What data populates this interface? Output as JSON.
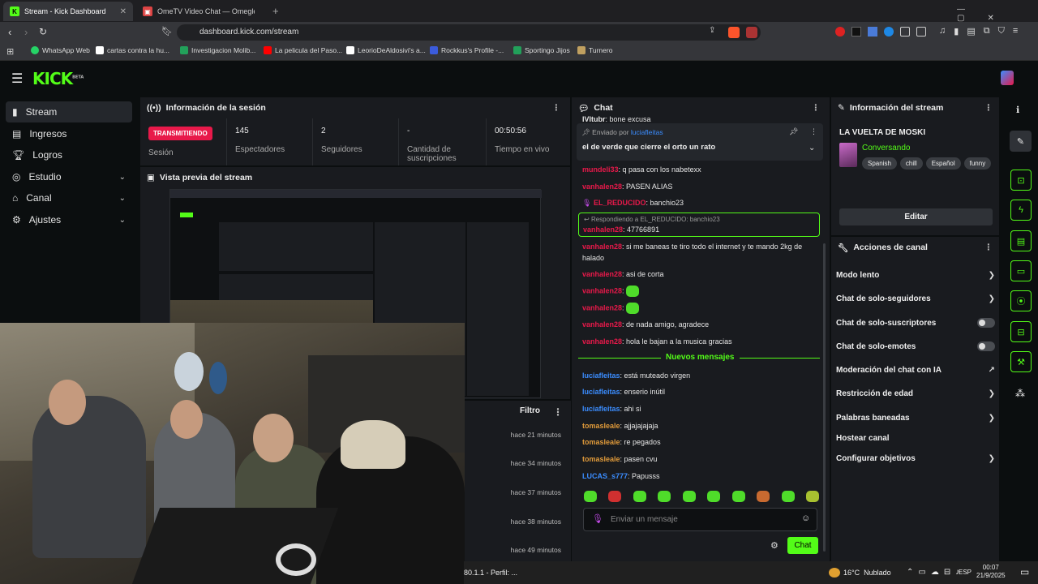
{
  "browser": {
    "tabs": [
      {
        "title": "Stream - Kick Dashboard",
        "active": true
      },
      {
        "title": "OmeTV Video Chat — Omegle Rand",
        "active": false
      }
    ],
    "url": "dashboard.kick.com/stream",
    "bookmarks": [
      {
        "label": "WhatsApp Web",
        "color": "#25d366"
      },
      {
        "label": "cartas contra la hu...",
        "color": "#ffffff"
      },
      {
        "label": "Investigacion Molib...",
        "color": "#22a05a"
      },
      {
        "label": "La pelicula del Paso...",
        "color": "#ff0000"
      },
      {
        "label": "LeorioDeAldosivi's a...",
        "color": "#ffffff"
      },
      {
        "label": "Rockkus's Profile -...",
        "color": "#3b5bdb"
      },
      {
        "label": "Sportingo Jijos",
        "color": "#22a05a"
      },
      {
        "label": "Turnero",
        "color": "#c0a060"
      }
    ]
  },
  "brand": {
    "logo": "KICK",
    "beta": "BETA",
    "accent": "#53fc18"
  },
  "nav": [
    {
      "label": "Stream",
      "icon": "broadcast-icon",
      "active": true,
      "chevron": false
    },
    {
      "label": "Ingresos",
      "icon": "wallet-icon",
      "active": false,
      "chevron": false
    },
    {
      "label": "Logros",
      "icon": "trophy-icon",
      "active": false,
      "chevron": false
    },
    {
      "label": "Estudio",
      "icon": "studio-icon",
      "active": false,
      "chevron": true
    },
    {
      "label": "Canal",
      "icon": "channel-icon",
      "active": false,
      "chevron": true
    },
    {
      "label": "Ajustes",
      "icon": "gear-icon",
      "active": false,
      "chevron": true
    }
  ],
  "session": {
    "title": "Información de la sesión",
    "status": "TRANSMITIENDO",
    "status_label": "Sesión",
    "stats": [
      {
        "value": "145",
        "label": "Espectadores"
      },
      {
        "value": "2",
        "label": "Seguidores"
      },
      {
        "value": "-",
        "label": "Cantidad de suscripciones"
      },
      {
        "value": "00:50:56",
        "label": "Tiempo en vivo"
      }
    ]
  },
  "preview": {
    "title": "Vista previa del stream"
  },
  "filter": {
    "label": "Filtro",
    "times": [
      "hace 21 minutos",
      "hace 34 minutos",
      "hace 37 minutos",
      "hace 38 minutos",
      "hace 49 minutos"
    ]
  },
  "chat": {
    "title": "Chat",
    "top_partial": {
      "user": "IVItubr",
      "text": ": bone excusa"
    },
    "pinned": {
      "prefix": "Enviado por",
      "user": "luciafleitas",
      "text": "el de verde que cierre el orto un rato"
    },
    "messages_old": [
      {
        "user": "mundeli33",
        "text": ": q pasa con los nabetexx",
        "color": "#e8194a"
      },
      {
        "user": "vanhalen28",
        "text": ": PASEN ALIAS",
        "color": "#e8194a"
      },
      {
        "user": "EL_REDUCIDO",
        "text": ": banchio23",
        "color": "#e8194a"
      }
    ],
    "reply": {
      "header": "Respondiendo a EL_REDUCIDO: banchio23",
      "user": "vanhalen28",
      "text": ": 47766891"
    },
    "messages_mid": [
      {
        "user": "vanhalen28",
        "text": ": si me baneas te tiro todo el internet y te mando 2kg de",
        "cont": "halado"
      },
      {
        "user": "vanhalen28",
        "text": ": asi de corta"
      },
      {
        "user": "vanhalen28",
        "text": ":",
        "emote": true
      },
      {
        "user": "vanhalen28",
        "text": ":",
        "emote": true
      },
      {
        "user": "vanhalen28",
        "text": ": de nada amigo, agradece"
      },
      {
        "user": "vanhalen28",
        "text": ": hola le bajan a la musica gracias"
      }
    ],
    "new_label": "Nuevos mensajes",
    "messages_new": [
      {
        "user": "luciafleitas",
        "text": ": está muteado virgen",
        "color": "#3b8dff"
      },
      {
        "user": "luciafleitas",
        "text": ": enserio inútil",
        "color": "#3b8dff"
      },
      {
        "user": "luciafleitas",
        "text": ": ahi si",
        "color": "#3b8dff"
      },
      {
        "user": "tomasleale",
        "text": ": ajjajajajaja",
        "color": "#e09a3a"
      },
      {
        "user": "tomasleale",
        "text": ": re pegados",
        "color": "#e09a3a"
      },
      {
        "user": "tomasleale",
        "text": ": pasen cvu",
        "color": "#e09a3a"
      },
      {
        "user": "LUCAS_s777",
        "text": ": Papusss",
        "color": "#3b8dff"
      }
    ],
    "input_placeholder": "Enviar un mensaje",
    "send_label": "Chat"
  },
  "stream_info": {
    "title": "Información del stream",
    "stream_title": "LA VUELTA DE MOSKI",
    "category": "Conversando",
    "tags": [
      "Spanish",
      "chill",
      "Español",
      "funny"
    ],
    "edit_label": "Editar"
  },
  "actions": {
    "title": "Acciones de canal",
    "items": [
      {
        "label": "Modo lento",
        "kind": "chevron"
      },
      {
        "label": "Chat de solo-seguidores",
        "kind": "chevron"
      },
      {
        "label": "Chat de solo-suscriptores",
        "kind": "toggle"
      },
      {
        "label": "Chat de solo-emotes",
        "kind": "toggle"
      },
      {
        "label": "Moderación del chat con IA",
        "kind": "external"
      },
      {
        "label": "Restricción de edad",
        "kind": "chevron"
      },
      {
        "label": "Palabras baneadas",
        "kind": "chevron"
      },
      {
        "label": "Hostear canal",
        "kind": "none"
      },
      {
        "label": "Configurar objetivos",
        "kind": "chevron"
      }
    ]
  },
  "taskbar": {
    "app_label": "80.1.1 - Perfil: ...",
    "weather": "16°C  Nublado",
    "lang": "ESP",
    "time": "00:07",
    "date": "21/9/2025"
  }
}
